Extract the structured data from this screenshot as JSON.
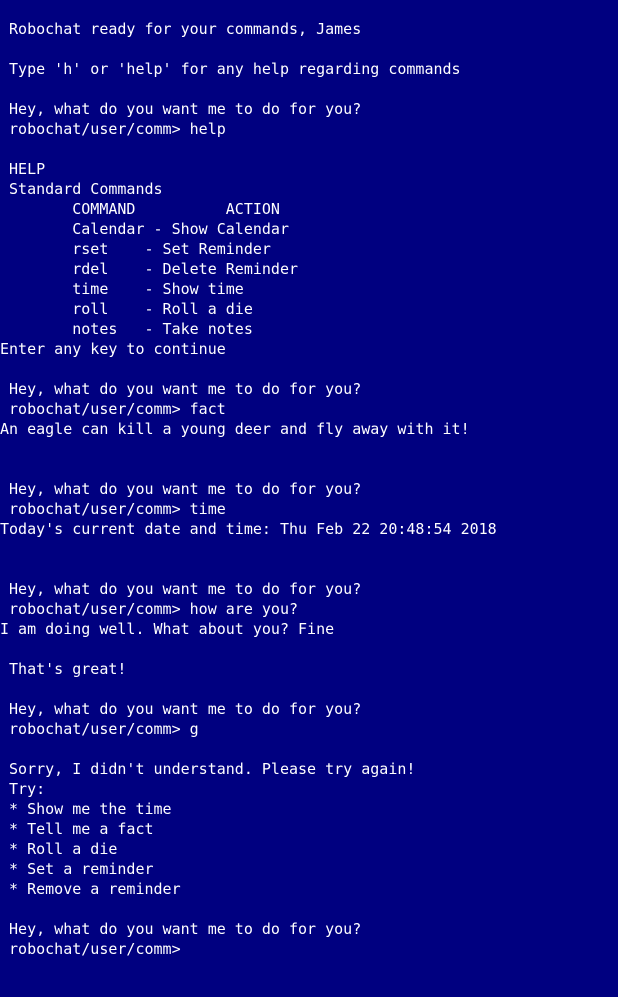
{
  "window": {
    "background": "#000080",
    "foreground": "#ffffff"
  },
  "lines": [
    " Robochat ready for your commands, James",
    "",
    " Type 'h' or 'help' for any help regarding commands",
    "",
    " Hey, what do you want me to do for you?",
    " robochat/user/comm> help",
    "",
    " HELP",
    " Standard Commands",
    "        COMMAND          ACTION",
    "        Calendar - Show Calendar",
    "        rset    - Set Reminder",
    "        rdel    - Delete Reminder",
    "        time    - Show time",
    "        roll    - Roll a die",
    "        notes   - Take notes",
    "Enter any key to continue",
    "",
    " Hey, what do you want me to do for you?",
    " robochat/user/comm> fact",
    "An eagle can kill a young deer and fly away with it!",
    "",
    "",
    " Hey, what do you want me to do for you?",
    " robochat/user/comm> time",
    "Today's current date and time: Thu Feb 22 20:48:54 2018",
    "",
    "",
    " Hey, what do you want me to do for you?",
    " robochat/user/comm> how are you?",
    "I am doing well. What about you? Fine",
    "",
    " That's great!",
    "",
    " Hey, what do you want me to do for you?",
    " robochat/user/comm> g",
    "",
    " Sorry, I didn't understand. Please try again!",
    " Try:",
    " * Show me the time",
    " * Tell me a fact",
    " * Roll a die",
    " * Set a reminder",
    " * Remove a reminder",
    "",
    " Hey, what do you want me to do for you?",
    " robochat/user/comm>"
  ]
}
